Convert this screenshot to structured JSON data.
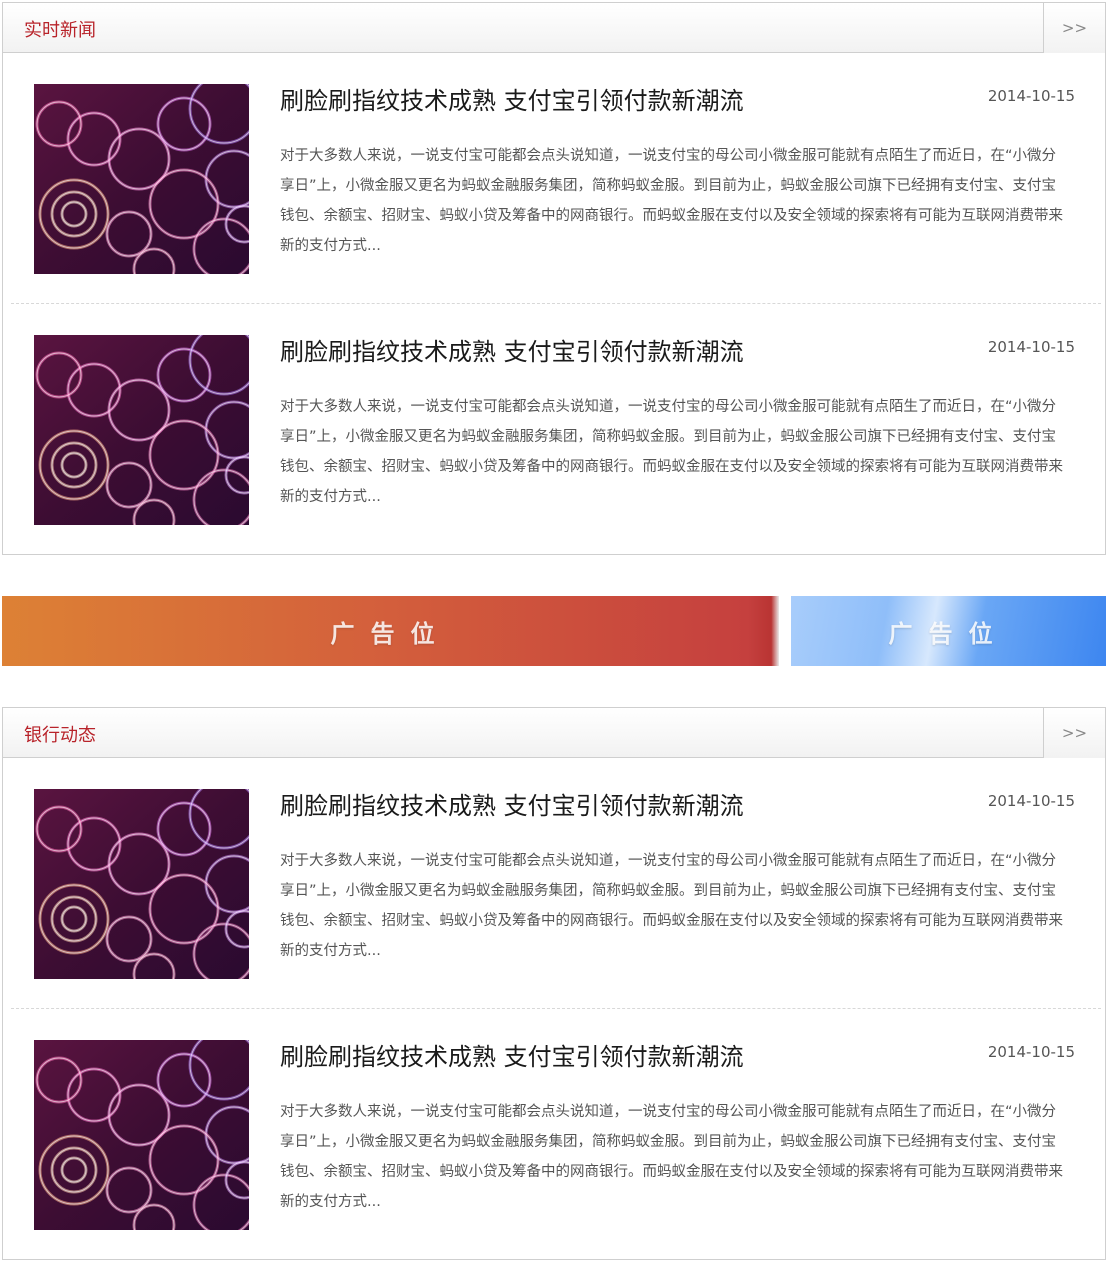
{
  "sections": [
    {
      "title": "实时新闻",
      "more": ">>",
      "articles": [
        {
          "title": "刷脸刷指纹技术成熟 支付宝引领付款新潮流",
          "date": "2014-10-15",
          "body": "对于大多数人来说，一说支付宝可能都会点头说知道，一说支付宝的母公司小微金服可能就有点陌生了而近日，在“小微分享日”上，小微金服又更名为蚂蚁金融服务集团，简称蚂蚁金服。到目前为止，蚂蚁金服公司旗下已经拥有支付宝、支付宝钱包、余额宝、招财宝、蚂蚁小贷及筹备中的网商银行。而蚂蚁金服在支付以及安全领域的探索将有可能为互联网消费带来新的支付方式..."
        },
        {
          "title": "刷脸刷指纹技术成熟 支付宝引领付款新潮流",
          "date": "2014-10-15",
          "body": "对于大多数人来说，一说支付宝可能都会点头说知道，一说支付宝的母公司小微金服可能就有点陌生了而近日，在“小微分享日”上，小微金服又更名为蚂蚁金融服务集团，简称蚂蚁金服。到目前为止，蚂蚁金服公司旗下已经拥有支付宝、支付宝钱包、余额宝、招财宝、蚂蚁小贷及筹备中的网商银行。而蚂蚁金服在支付以及安全领域的探索将有可能为互联网消费带来新的支付方式..."
        }
      ]
    },
    {
      "title": "银行动态",
      "more": ">>",
      "articles": [
        {
          "title": "刷脸刷指纹技术成熟 支付宝引领付款新潮流",
          "date": "2014-10-15",
          "body": "对于大多数人来说，一说支付宝可能都会点头说知道，一说支付宝的母公司小微金服可能就有点陌生了而近日，在“小微分享日”上，小微金服又更名为蚂蚁金融服务集团，简称蚂蚁金服。到目前为止，蚂蚁金服公司旗下已经拥有支付宝、支付宝钱包、余额宝、招财宝、蚂蚁小贷及筹备中的网商银行。而蚂蚁金服在支付以及安全领域的探索将有可能为互联网消费带来新的支付方式..."
        },
        {
          "title": "刷脸刷指纹技术成熟 支付宝引领付款新潮流",
          "date": "2014-10-15",
          "body": "对于大多数人来说，一说支付宝可能都会点头说知道，一说支付宝的母公司小微金服可能就有点陌生了而近日，在“小微分享日”上，小微金服又更名为蚂蚁金融服务集团，简称蚂蚁金服。到目前为止，蚂蚁金服公司旗下已经拥有支付宝、支付宝钱包、余额宝、招财宝、蚂蚁小贷及筹备中的网商银行。而蚂蚁金服在支付以及安全领域的探索将有可能为互联网消费带来新的支付方式..."
        }
      ]
    }
  ],
  "ads": {
    "left_label": "广告位",
    "right_label": "广告位"
  },
  "colors": {
    "section_title": "#b8232a",
    "ad_left": "#d35e3c",
    "ad_right": "#3d86f0"
  }
}
